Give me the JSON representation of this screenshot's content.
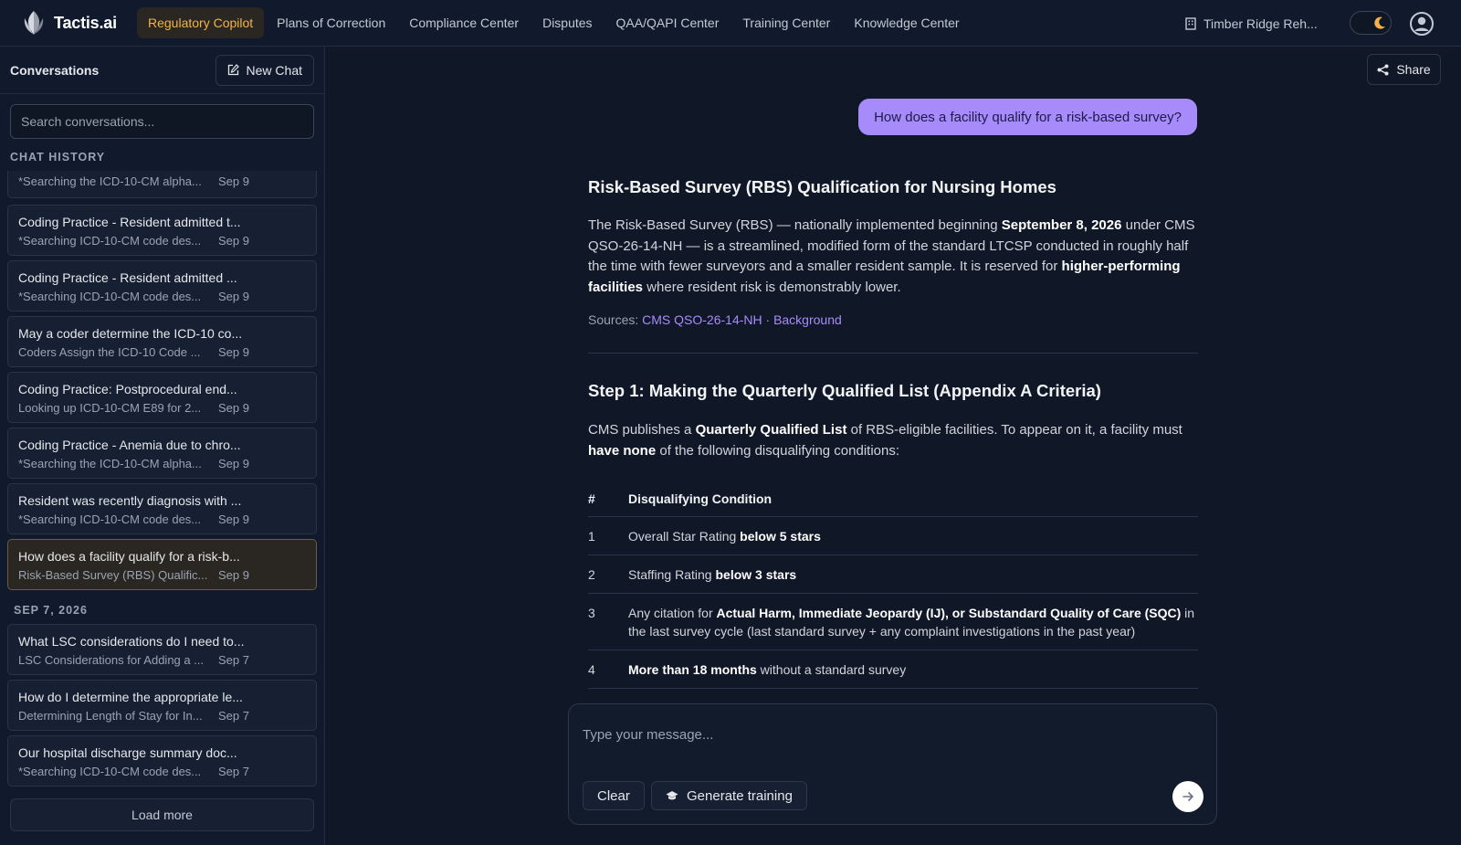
{
  "brand": {
    "name": "Tactis.ai",
    "logo_icon": "leaf-logo-icon"
  },
  "nav": {
    "items": [
      {
        "label": "Regulatory Copilot",
        "active": true
      },
      {
        "label": "Plans of Correction",
        "active": false
      },
      {
        "label": "Compliance Center",
        "active": false
      },
      {
        "label": "Disputes",
        "active": false
      },
      {
        "label": "QAA/QAPI Center",
        "active": false
      },
      {
        "label": "Training Center",
        "active": false
      },
      {
        "label": "Knowledge Center",
        "active": false
      }
    ],
    "facility": "Timber Ridge Reh...",
    "theme": "dark"
  },
  "sidebar": {
    "title": "Conversations",
    "new_chat_label": "New Chat",
    "search_placeholder": "Search conversations...",
    "section_history": "CHAT HISTORY",
    "partial_item": {
      "preview": "*Searching the ICD-10-CM alpha...",
      "date": "Sep 9"
    },
    "history_items": [
      {
        "title": "Coding Practice - Resident admitted t...",
        "preview": "*Searching ICD-10-CM code des...",
        "date": "Sep 9"
      },
      {
        "title": "Coding Practice - Resident admitted ...",
        "preview": "*Searching ICD-10-CM code des...",
        "date": "Sep 9"
      },
      {
        "title": "May a coder determine the ICD-10 co...",
        "preview": "Coders Assign the ICD-10 Code ...",
        "date": "Sep 9"
      },
      {
        "title": "Coding Practice: Postprocedural end...",
        "preview": "Looking up ICD-10-CM E89 for 2...",
        "date": "Sep 9"
      },
      {
        "title": "Coding Practice - Anemia due to chro...",
        "preview": "*Searching the ICD-10-CM alpha...",
        "date": "Sep 9"
      },
      {
        "title": "Resident was recently diagnosis with ...",
        "preview": "*Searching ICD-10-CM code des...",
        "date": "Sep 9"
      },
      {
        "title": "How does a facility qualify for a risk-b...",
        "preview": "Risk-Based Survey (RBS) Qualific...",
        "date": "Sep 9",
        "active": true
      }
    ],
    "section_sep7": "SEP 7, 2026",
    "sep7_items": [
      {
        "title": "What LSC considerations do I need to...",
        "preview": "LSC Considerations for Adding a ...",
        "date": "Sep 7"
      },
      {
        "title": "How do I determine the appropriate le...",
        "preview": "Determining Length of Stay for In...",
        "date": "Sep 7"
      },
      {
        "title": "Our hospital discharge summary doc...",
        "preview": "*Searching ICD-10-CM code des...",
        "date": "Sep 7"
      }
    ],
    "load_more": "Load more"
  },
  "main": {
    "share_label": "Share",
    "user_message": "How does a facility qualify for a risk-based survey?",
    "answer": {
      "title": "Risk-Based Survey (RBS) Qualification for Nursing Homes",
      "intro_1": "The Risk-Based Survey (RBS) — nationally implemented beginning ",
      "intro_b1": "September 8, 2026",
      "intro_2": " under CMS QSO-26-14-NH — is a streamlined, modified form of the standard LTCSP conducted in roughly half the time with fewer surveyors and a smaller resident sample. It is reserved for ",
      "intro_b2": "higher-performing facilities",
      "intro_3": " where resident risk is demonstrably lower.",
      "sources_label": "Sources:",
      "source_1": "CMS QSO-26-14-NH",
      "source_sep": " · ",
      "source_2": "Background",
      "step1_title": "Step 1: Making the Quarterly Qualified List (Appendix A Criteria)",
      "step1_1": "CMS publishes a ",
      "step1_b1": "Quarterly Qualified List",
      "step1_2": " of RBS-eligible facilities. To appear on it, a facility must ",
      "step1_b2": "have none",
      "step1_3": " of the following disqualifying conditions:",
      "table_head_num": "#",
      "table_head_cond": "Disqualifying Condition",
      "rows": [
        {
          "num": "1",
          "pre": "Overall Star Rating ",
          "bold": "below 5 stars",
          "post": ""
        },
        {
          "num": "2",
          "pre": "Staffing Rating ",
          "bold": "below 3 stars",
          "post": ""
        },
        {
          "num": "3",
          "pre": "Any citation for ",
          "bold": "Actual Harm, Immediate Jeopardy (IJ), or Substandard Quality of Care (SQC)",
          "post": " in the last survey cycle (last standard survey + any complaint investigations in the past year)"
        },
        {
          "num": "4",
          "pre": "",
          "bold": "More than 18 months",
          "post": " without a standard survey"
        }
      ]
    },
    "composer": {
      "placeholder": "Type your message...",
      "clear_label": "Clear",
      "generate_label": "Generate training"
    }
  }
}
